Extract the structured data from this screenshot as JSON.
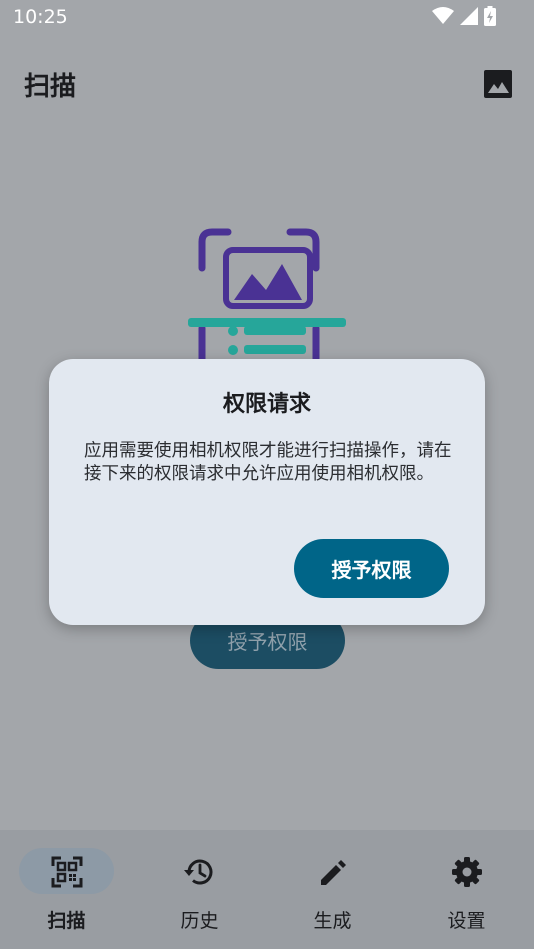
{
  "status": {
    "time": "10:25"
  },
  "app_bar": {
    "title": "扫描",
    "gallery_icon": "image-icon"
  },
  "background": {
    "grant_label": "授予权限"
  },
  "dialog": {
    "title": "权限请求",
    "message": "应用需要使用相机权限才能进行扫描操作，请在接下来的权限请求中允许应用使用相机权限。",
    "confirm_label": "授予权限"
  },
  "nav": {
    "items": [
      {
        "label": "扫描",
        "icon": "qr-code-icon"
      },
      {
        "label": "历史",
        "icon": "history-icon"
      },
      {
        "label": "生成",
        "icon": "pencil-icon"
      },
      {
        "label": "设置",
        "icon": "gear-icon"
      }
    ]
  },
  "colors": {
    "scrim": "#a3a6aa",
    "dialog": "#e2e8f0",
    "primary": "#006588",
    "illustration_purple": "#4a3294",
    "illustration_teal": "#26a69a"
  }
}
